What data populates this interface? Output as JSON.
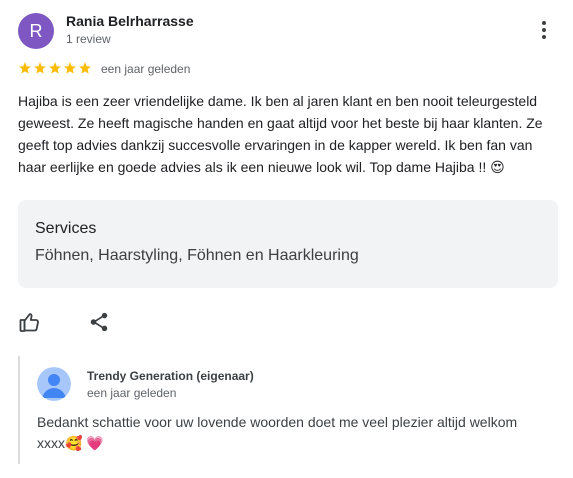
{
  "review": {
    "author": {
      "initial": "R",
      "name": "Rania Belrharrasse",
      "meta": "1 review",
      "avatar_color": "#7e57c2"
    },
    "rating": 5,
    "star_color": "#fbbc04",
    "date": "een jaar geleden",
    "text": "Hajiba is een zeer vriendelijke dame. Ik ben al jaren klant en ben nooit teleurgesteld geweest. Ze heeft magische handen en gaat altijd voor het beste bij haar klanten. Ze geeft top advies dankzij succesvolle ervaringen in de kapper wereld. Ik ben fan van haar eerlijke en goede advies als ik een nieuwe look wil. Top dame Hajiba !! 😍",
    "services": {
      "title": "Services",
      "value": "Föhnen, Haarstyling, Föhnen en Haarkleuring"
    },
    "actions": {
      "like_icon": "thumbs-up-icon",
      "share_icon": "share-icon",
      "menu_icon": "more-vertical-icon"
    }
  },
  "owner_reply": {
    "name": "Trendy Generation (eigenaar)",
    "date": "een jaar geleden",
    "text": "Bedankt schattie voor uw lovende woorden doet me veel plezier altijd welkom xxxx🥰 💗",
    "avatar_color": "#4285f4"
  }
}
